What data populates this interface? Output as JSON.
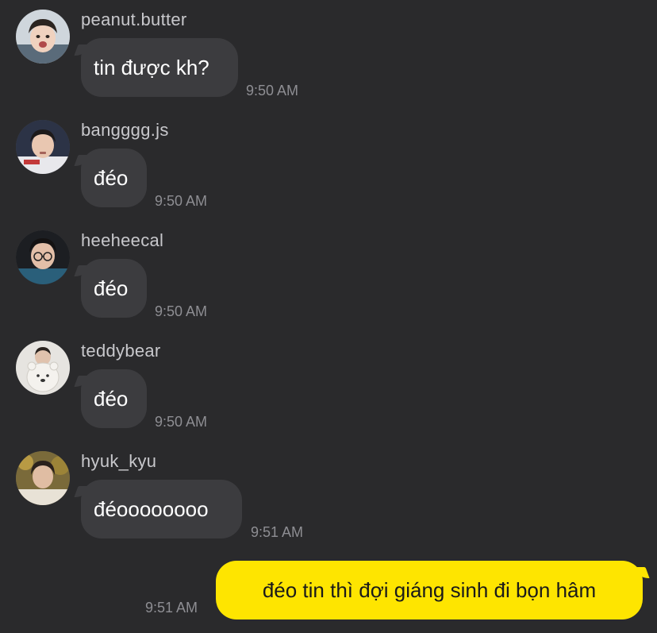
{
  "messages": [
    {
      "username": "peanut.butter",
      "text": "tin được kh?",
      "time": "9:50 AM",
      "avatar_icon": "person-avatar-icon"
    },
    {
      "username": "bangggg.js",
      "text": "đéo",
      "time": "9:50 AM",
      "avatar_icon": "person-avatar-icon"
    },
    {
      "username": "heeheecal",
      "text": "đéo",
      "time": "9:50 AM",
      "avatar_icon": "person-avatar-icon"
    },
    {
      "username": "teddybear",
      "text": "đéo",
      "time": "9:50 AM",
      "avatar_icon": "person-avatar-icon"
    },
    {
      "username": "hyuk_kyu",
      "text": "đéoooooooo",
      "time": "9:51 AM",
      "avatar_icon": "person-avatar-icon"
    }
  ],
  "my_message": {
    "text": "đéo tin thì đợi giáng sinh đi bọn hâm",
    "time": "9:51 AM"
  },
  "colors": {
    "background": "#2a2a2c",
    "incoming_bubble": "#3c3c3f",
    "outgoing_bubble": "#fee500",
    "timestamp": "#8e8e93",
    "username": "#c8c8cc"
  }
}
